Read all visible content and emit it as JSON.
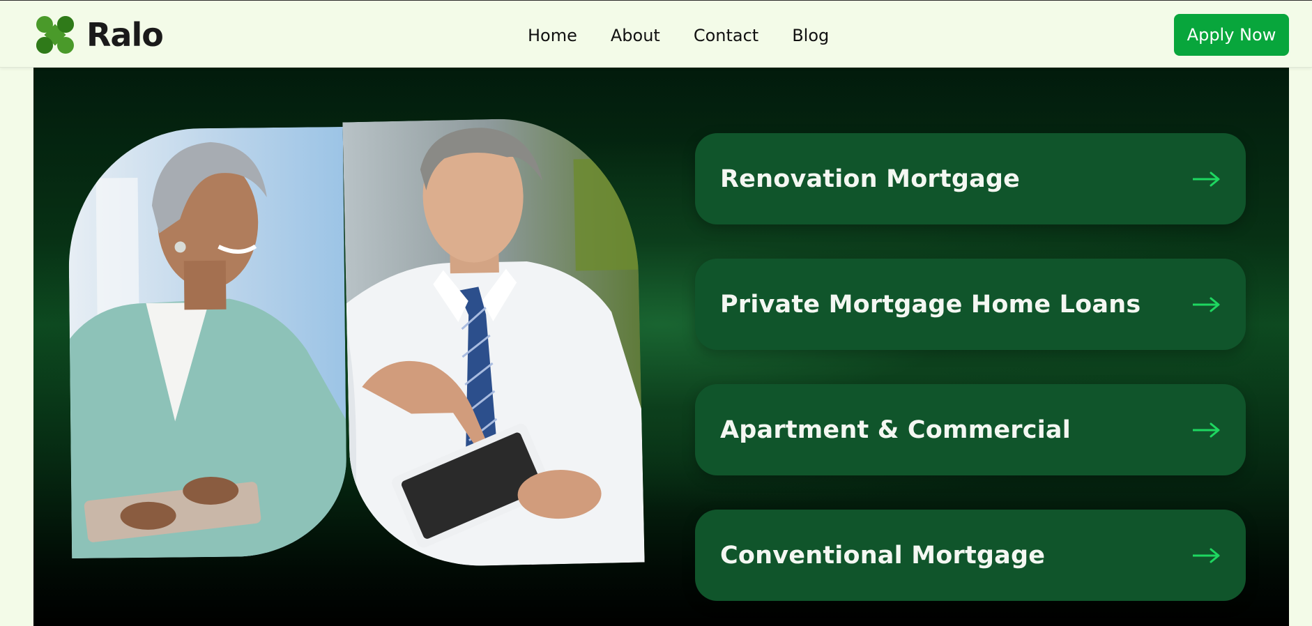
{
  "brand": {
    "name": "Ralo",
    "logo_color": "#4a9a2a"
  },
  "nav": {
    "items": [
      {
        "label": "Home"
      },
      {
        "label": "About"
      },
      {
        "label": "Contact"
      },
      {
        "label": "Blog"
      }
    ]
  },
  "header": {
    "cta_label": "Apply Now",
    "cta_color": "#08a63c"
  },
  "hero": {
    "photos": [
      {
        "subject": "smiling woman with tablet",
        "icon": "photo-woman"
      },
      {
        "subject": "man in shirt and tie pointing at tablet",
        "icon": "photo-man"
      }
    ],
    "services": [
      {
        "title": "Renovation Mortgage",
        "icon": "arrow-right-icon"
      },
      {
        "title": "Private Mortgage Home Loans",
        "icon": "arrow-right-icon"
      },
      {
        "title": "Apartment & Commercial",
        "icon": "arrow-right-icon"
      },
      {
        "title": "Conventional Mortgage",
        "icon": "arrow-right-icon"
      }
    ],
    "accent_color": "#1ed760",
    "card_color": "#10552b"
  }
}
